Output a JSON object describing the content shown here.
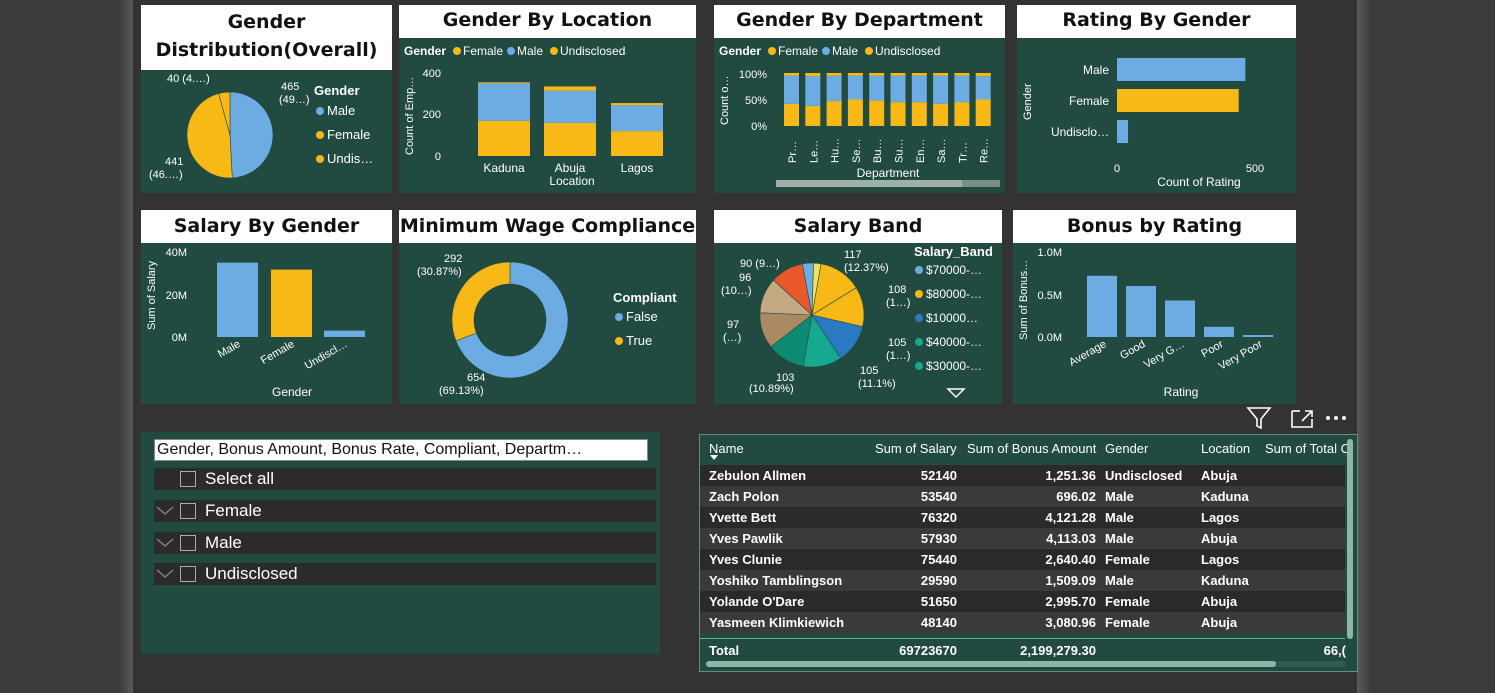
{
  "colors": {
    "bg": "#214a40",
    "female": "#f8b916",
    "male": "#6cace3",
    "undisclosed": "#f8b916",
    "title_bg": "#ffffff"
  },
  "gender_dist": {
    "title_l1": "Gender",
    "title_l2": "Distribution(Overall)",
    "legend_title": "Gender",
    "legend": [
      "Male",
      "Female",
      "Undis…"
    ],
    "labels": {
      "l40": "40 (4.…)",
      "l465a": "465",
      "l465b": "(49…)",
      "l441a": "441",
      "l441b": "(46.…)"
    },
    "chart_data": {
      "type": "pie",
      "categories": [
        "Male",
        "Female",
        "Undisclosed"
      ],
      "values": [
        465,
        441,
        40
      ]
    }
  },
  "gender_location": {
    "title": "Gender By Location",
    "legend_title": "Gender",
    "legend": [
      "Female",
      "Male",
      "Undisclosed"
    ],
    "ylabel": "Count of Emp…",
    "xlabel": "Location",
    "yticks": [
      "400",
      "200",
      "0"
    ],
    "chart_data": {
      "type": "bar",
      "stacked": true,
      "categories": [
        "Kaduna",
        "Abuja",
        "Lagos"
      ],
      "ylim": [
        0,
        400
      ],
      "series": [
        {
          "name": "Female",
          "values": [
            170,
            160,
            120
          ]
        },
        {
          "name": "Male",
          "values": [
            180,
            155,
            125
          ]
        },
        {
          "name": "Undisclosed",
          "values": [
            5,
            20,
            10
          ]
        }
      ]
    }
  },
  "gender_department": {
    "title": "Gender By Department",
    "legend_title": "Gender",
    "legend": [
      "Female",
      "Male",
      "Undisclosed"
    ],
    "ylabel": "Count o…",
    "xlabel": "Department",
    "yticks": [
      "100%",
      "50%",
      "0%"
    ],
    "chart_data": {
      "type": "bar",
      "stacked": true,
      "percent": true,
      "categories": [
        "Pr…",
        "Le…",
        "Hu…",
        "Se…",
        "Bu…",
        "Su…",
        "En…",
        "Sa…",
        "Tr…",
        "Re…"
      ],
      "series": [
        {
          "name": "Female",
          "values": [
            42,
            38,
            47,
            50,
            48,
            45,
            45,
            42,
            45,
            50
          ]
        },
        {
          "name": "Male",
          "values": [
            53,
            56,
            48,
            45,
            47,
            50,
            50,
            53,
            50,
            44
          ]
        },
        {
          "name": "Undisclosed",
          "values": [
            5,
            6,
            5,
            5,
            5,
            5,
            5,
            5,
            5,
            6
          ]
        }
      ]
    }
  },
  "rating_gender": {
    "title": "Rating By Gender",
    "ylabel": "Gender",
    "xlabel": "Count of Rating",
    "xticks": [
      "0",
      "500"
    ],
    "chart_data": {
      "type": "bar",
      "orientation": "horizontal",
      "categories": [
        "Male",
        "Female",
        "Undisclo…"
      ],
      "values": [
        465,
        441,
        40
      ],
      "xlim": [
        0,
        500
      ]
    }
  },
  "salary_gender": {
    "title": "Salary By Gender",
    "ylabel": "Sum of Salary",
    "xlabel": "Gender",
    "yticks": [
      "40M",
      "20M",
      "0M"
    ],
    "chart_data": {
      "type": "bar",
      "categories": [
        "Male",
        "Female",
        "Undiscl…"
      ],
      "values": [
        35000000,
        31700000,
        3000000
      ],
      "ylim": [
        0,
        40000000
      ]
    }
  },
  "wage_compliance": {
    "title": "Minimum Wage Compliance",
    "legend_title": "Compliant",
    "legend": [
      "False",
      "True"
    ],
    "labels": {
      "la1": "292",
      "la2": "(30.87%)",
      "lb1": "654",
      "lb2": "(69.13%)"
    },
    "chart_data": {
      "type": "pie",
      "donut": true,
      "categories": [
        "False",
        "True"
      ],
      "values": [
        654,
        292
      ]
    }
  },
  "salary_band": {
    "title": "Salary Band",
    "legend_title": "Salary_Band",
    "legend": [
      "$70000-…",
      "$80000-…",
      "$10000…",
      "$40000-…",
      "$30000-…"
    ],
    "labels": {
      "a1": "117",
      "a2": "(12.37%)",
      "b1": "108",
      "b2": "(1…)",
      "c1": "105",
      "c2": "(1…)",
      "d1": "105",
      "d2": "(11.1%)",
      "e1": "103",
      "e2": "(10.89%)",
      "f1": "97",
      "f2": "(…)",
      "g1": "96",
      "g2": "(10…)",
      "h1": "90 (9…)"
    },
    "chart_data": {
      "type": "pie",
      "values": [
        117,
        108,
        105,
        105,
        103,
        97,
        96,
        90,
        30,
        20
      ]
    }
  },
  "bonus_rating": {
    "title": "Bonus by Rating",
    "ylabel": "Sum of Bonus…",
    "xlabel": "Rating",
    "yticks": [
      "1.0M",
      "0.5M",
      "0.0M"
    ],
    "chart_data": {
      "type": "bar",
      "categories": [
        "Average",
        "Good",
        "Very G…",
        "Poor",
        "Very Poor"
      ],
      "values": [
        720000,
        600000,
        430000,
        120000,
        20000
      ],
      "ylim": [
        0,
        1000000
      ]
    }
  },
  "slicer": {
    "search": "Gender, Bonus Amount, Bonus Rate, Compliant, Departm…",
    "items": [
      "Select all",
      "Female",
      "Male",
      "Undisclosed"
    ]
  },
  "table": {
    "headers": [
      "Name",
      "Sum of Salary",
      "Sum of Bonus Amount",
      "Gender",
      "Location",
      "Sum of Total C"
    ],
    "rows": [
      [
        "Zebulon Allmen",
        "52140",
        "1,251.36",
        "Undisclosed",
        "Abuja"
      ],
      [
        "Zach Polon",
        "53540",
        "696.02",
        "Male",
        "Kaduna"
      ],
      [
        "Yvette Bett",
        "76320",
        "4,121.28",
        "Male",
        "Lagos"
      ],
      [
        "Yves Pawlik",
        "57930",
        "4,113.03",
        "Male",
        "Abuja"
      ],
      [
        "Yves Clunie",
        "75440",
        "2,640.40",
        "Female",
        "Lagos"
      ],
      [
        "Yoshiko Tamblingson",
        "29590",
        "1,509.09",
        "Male",
        "Kaduna"
      ],
      [
        "Yolande O'Dare",
        "51650",
        "2,995.70",
        "Female",
        "Abuja"
      ],
      [
        "Yasmeen Klimkiewich",
        "48140",
        "3,080.96",
        "Female",
        "Abuja"
      ]
    ],
    "total": {
      "label": "Total",
      "salary": "69723670",
      "bonus": "2,199,279.30",
      "extra": "66,("
    }
  }
}
